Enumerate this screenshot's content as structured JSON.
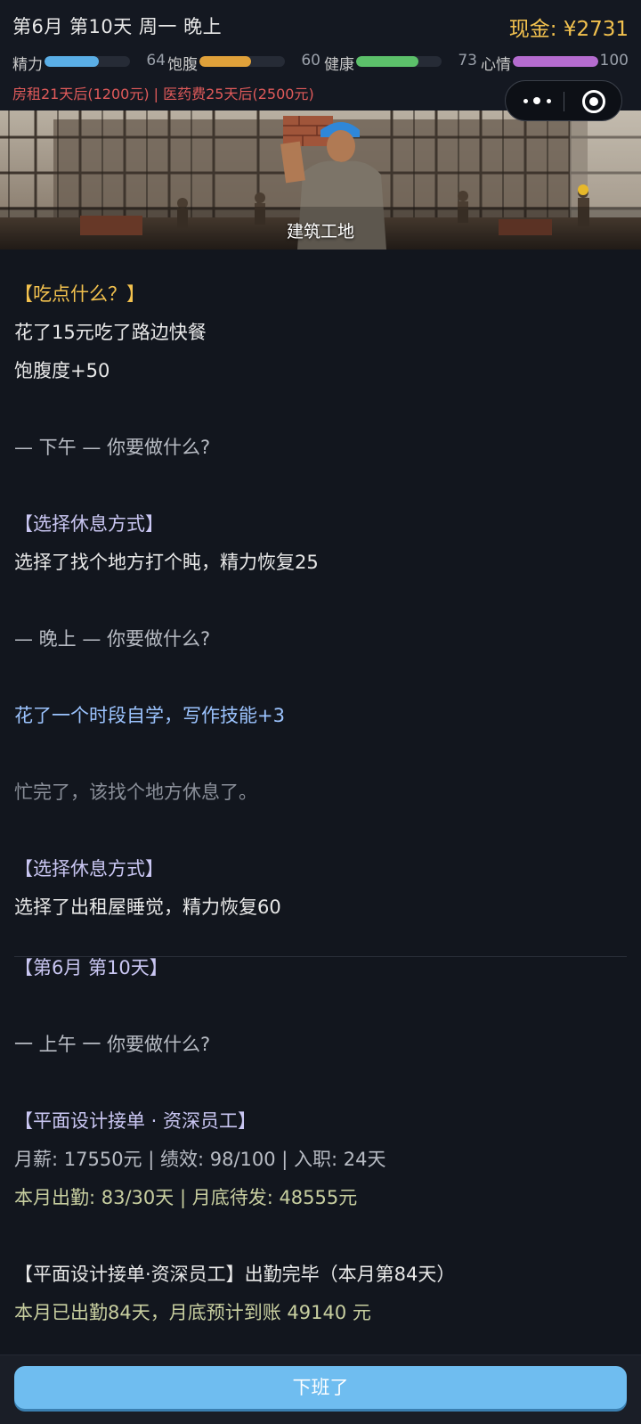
{
  "header": {
    "date": "第6月 第10天 周一 晚上",
    "cash": "现金: ¥2731",
    "bills": "房租21天后(1200元) | 医药费25天后(2500元)"
  },
  "stats": [
    {
      "label": "精力",
      "value": 64,
      "display": "64",
      "color": "#5aaee6"
    },
    {
      "label": "饱腹",
      "value": 60,
      "display": "60",
      "color": "#e0a13a"
    },
    {
      "label": "健康",
      "value": 73,
      "display": "73",
      "color": "#5cc06a"
    },
    {
      "label": "心情",
      "value": 100,
      "display": "100",
      "color": "#b56cd0"
    }
  ],
  "banner": {
    "caption": "建筑工地"
  },
  "log": {
    "eat_title": "【吃点什么？】",
    "eat_line1": "花了15元吃了路边快餐",
    "eat_line2": "饱腹度+50",
    "afternoon": "— 下午 —  你要做什么?",
    "rest_title1": "【选择休息方式】",
    "rest_line1": "选择了找个地方打个盹，精力恢复25",
    "evening": "— 晚上 —  你要做什么?",
    "study": "花了一个时段自学，写作技能+3",
    "done": "忙完了，该找个地方休息了。",
    "rest_title2": "【选择休息方式】",
    "rest_line2": "选择了出租屋睡觉，精力恢复60",
    "day_title": "【第6月 第10天】",
    "morning": "一 上午 一  你要做什么?",
    "job_title": "【平面设计接单 · 资深员工】",
    "job_line1": "月薪: 17550元 | 绩效: 98/100 | 入职: 24天",
    "job_line2": "本月出勤: 83/30天 | 月底待发: 48555元",
    "job_done_title": "【平面设计接单·资深员工】出勤完毕（本月第84天）",
    "job_done_line": "本月已出勤84天，月底预计到账 49140 元"
  },
  "button": {
    "label": "下班了"
  }
}
